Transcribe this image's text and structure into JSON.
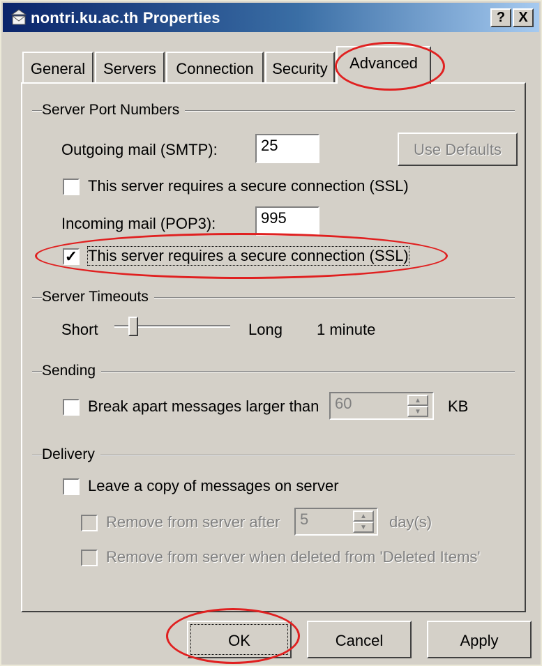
{
  "window": {
    "title": "nontri.ku.ac.th Properties",
    "help_button": "?",
    "close_button": "X"
  },
  "tabs": [
    "General",
    "Servers",
    "Connection",
    "Security",
    "Advanced"
  ],
  "active_tab": "Advanced",
  "server_ports": {
    "group_label": "Server Port Numbers",
    "outgoing_label": "Outgoing mail (SMTP):",
    "outgoing_value": "25",
    "use_defaults_label": "Use Defaults",
    "outgoing_ssl_label": "This server requires a secure connection (SSL)",
    "outgoing_ssl_checked": false,
    "incoming_label": "Incoming mail (POP3):",
    "incoming_value": "995",
    "incoming_ssl_label": "This server requires a secure connection (SSL)",
    "incoming_ssl_checked": true
  },
  "timeouts": {
    "group_label": "Server Timeouts",
    "short_label": "Short",
    "long_label": "Long",
    "value_text": "1 minute",
    "slider_fraction": 0.12
  },
  "sending": {
    "group_label": "Sending",
    "break_apart_label": "Break apart messages larger than",
    "break_apart_checked": false,
    "size_value": "60",
    "unit_label": "KB"
  },
  "delivery": {
    "group_label": "Delivery",
    "leave_copy_label": "Leave a copy of messages on server",
    "leave_copy_checked": false,
    "remove_after_label": "Remove from server after",
    "remove_after_value": "5",
    "days_label": "day(s)",
    "remove_deleted_label": "Remove from server when deleted from 'Deleted Items'"
  },
  "buttons": {
    "ok": "OK",
    "cancel": "Cancel",
    "apply": "Apply"
  },
  "colors": {
    "annotation": "#e02020",
    "titlebar": "#0a246a",
    "face": "#d4d0c8"
  }
}
